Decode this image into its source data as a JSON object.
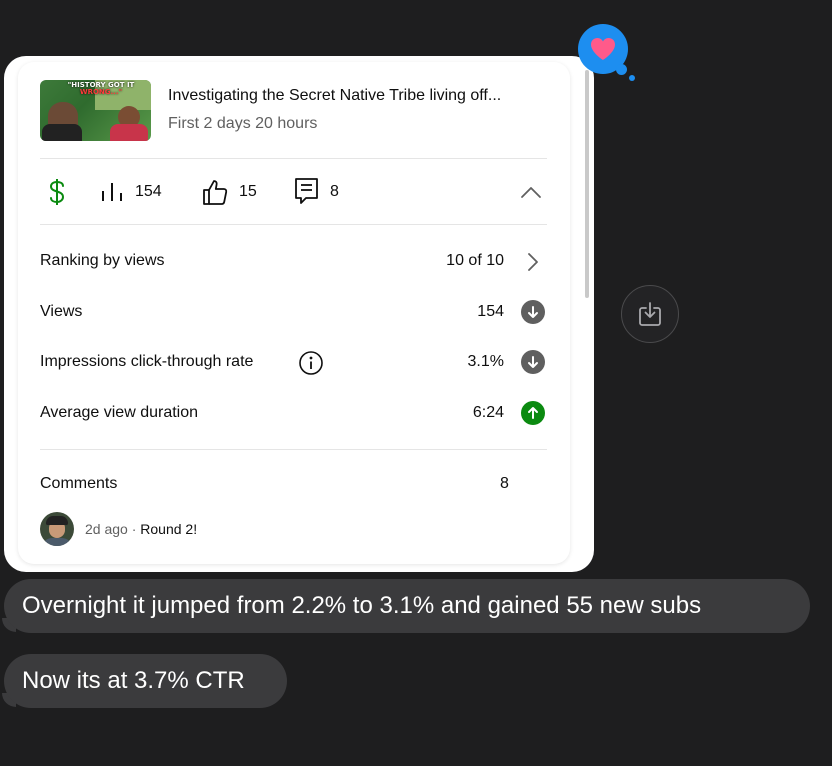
{
  "video": {
    "thumbnail_caption_line1": "\"HISTORY GOT IT",
    "thumbnail_caption_line2": "WRONG...\"",
    "title": "Investigating the Secret Native Tribe living off...",
    "subtitle": "First 2 days 20 hours"
  },
  "stats": {
    "revenue_icon": "dollar-icon",
    "views": "154",
    "likes": "15",
    "comments": "8"
  },
  "metrics": [
    {
      "label": "Ranking by views",
      "value": "10 of 10"
    },
    {
      "label": "Views",
      "value": "154",
      "trend": "down"
    },
    {
      "label": "Impressions click-through rate",
      "value": "3.1%",
      "trend": "down"
    },
    {
      "label": "Average view duration",
      "value": "6:24",
      "trend": "up"
    }
  ],
  "comments_section": {
    "label": "Comments",
    "count": "8",
    "latest": {
      "time": "2d ago",
      "separator": " · ",
      "text": "Round 2!"
    }
  },
  "messages": [
    {
      "text": "Overnight it jumped from 2.2% to 3.1% and gained 55 new subs"
    },
    {
      "text": "Now its at 3.7% CTR"
    }
  ],
  "colors": {
    "background": "#1e1e1f",
    "bubble": "#3b3b3d",
    "reaction": "#1d8ef0",
    "heart": "#ff5a8a",
    "revenue_green": "#0b8a10",
    "trend_up": "#0b8a10",
    "trend_down": "#5f5f5f"
  }
}
